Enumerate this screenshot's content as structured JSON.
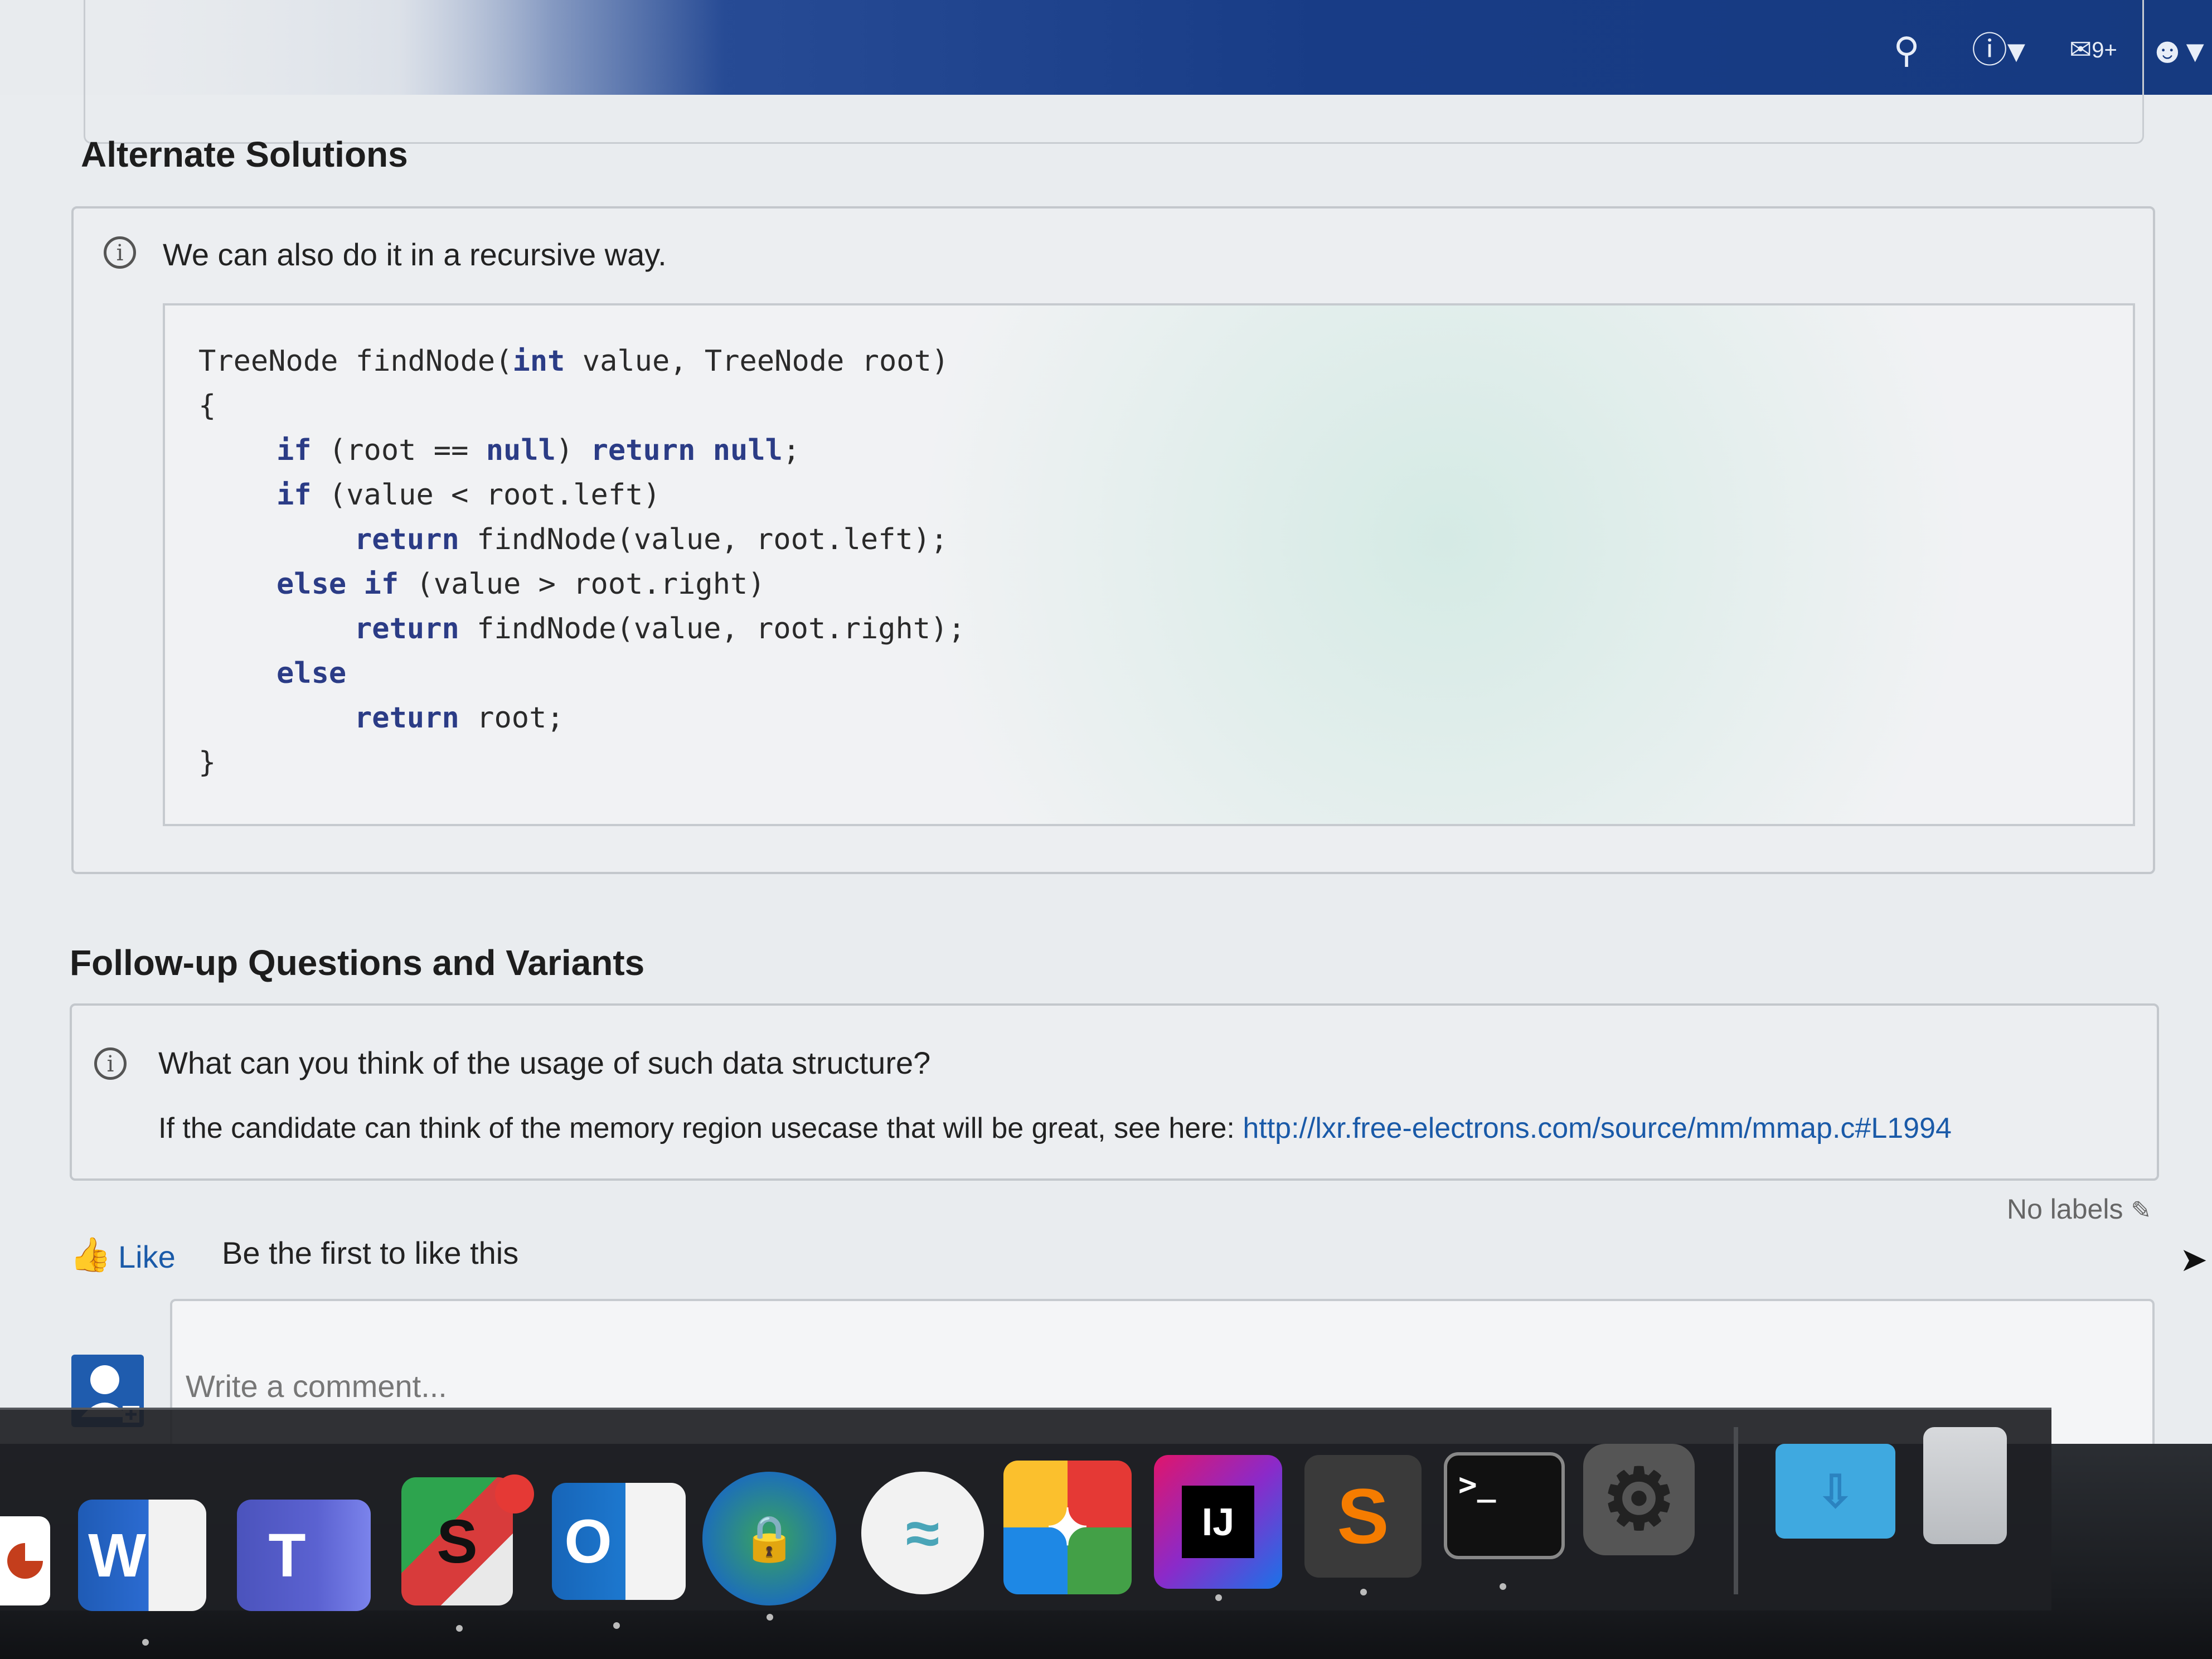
{
  "alternate": {
    "heading": "Alternate Solutions",
    "info_text": "We can also do it in a recursive way.",
    "code": [
      "TreeNode findNode(int value, TreeNode root)",
      "{",
      "if (root == null) return null;",
      "if (value < root.left)",
      "return findNode(value, root.left);",
      "else if (value > root.right)",
      "return findNode(value, root.right);",
      "else",
      "return root;",
      "}"
    ]
  },
  "followup": {
    "heading": "Follow-up Questions and Variants",
    "question": "What can you think of the usage of such data structure?",
    "answer_prefix": "If the candidate can think of the memory region usecase that will be great, see here: ",
    "answer_link": "http://lxr.free-electrons.com/source/mm/mmap.c#L1994"
  },
  "labels": {
    "text": "No labels"
  },
  "like": {
    "label": "Like",
    "status": "Be the first to like this"
  },
  "comment": {
    "placeholder": "Write a comment..."
  },
  "topbar": {
    "notifications_badge": "9+"
  },
  "dock": {
    "apps": [
      "PowerPoint",
      "Word",
      "Teams",
      "Skype",
      "Outlook",
      "Global Protect",
      "Wi-Fi",
      "Launchpad",
      "IntelliJ IDEA",
      "Sublime Text",
      "Terminal",
      "System Preferences",
      "Downloads",
      "Trash"
    ],
    "word_letter": "W",
    "teams_letter": "T",
    "skype_letter": "S",
    "outlook_letter": "O",
    "intellij_letters": "IJ",
    "terminal_prompt": ">_"
  }
}
